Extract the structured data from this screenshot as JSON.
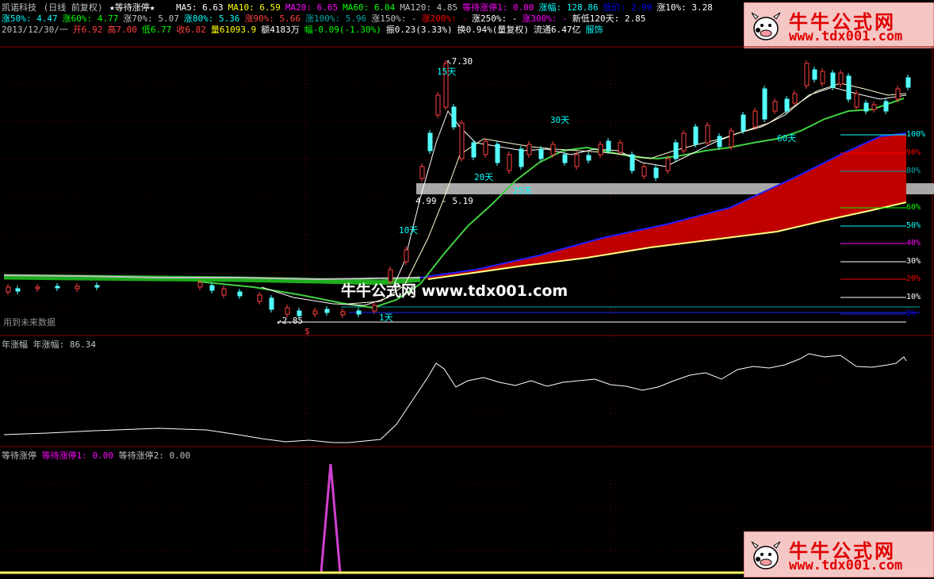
{
  "header": {
    "stock_name": "凯诺科技",
    "period": "(日线 前复权)",
    "indicator_name": "★等待涨停★",
    "ma": [
      {
        "label": "MA5: 6.63",
        "color": "#ffffff"
      },
      {
        "label": "MA10: 6.59",
        "color": "#ffff00"
      },
      {
        "label": "MA20: 6.65",
        "color": "#ff00ff"
      },
      {
        "label": "MA60: 6.04",
        "color": "#00ff00"
      },
      {
        "label": "MA120: 4.85",
        "color": "#c0c0c0"
      },
      {
        "label": "等待涨停1: 0.00",
        "color": "#ff00ff"
      },
      {
        "label": "涨幅: 128.86",
        "color": "#00ffff"
      },
      {
        "label": "低价: 2.99",
        "color": "#0000ff"
      },
      {
        "label": "涨10%: 3.28",
        "color": "#ffffff"
      }
    ],
    "targets": [
      {
        "label": "涨50%: 4.47",
        "color": "#00ffff"
      },
      {
        "label": "涨60%: 4.77",
        "color": "#00ff00"
      },
      {
        "label": "涨70%: 5.07",
        "color": "#c0c0c0"
      },
      {
        "label": "涨80%: 5.36",
        "color": "#00ffff"
      },
      {
        "label": "涨90%: 5.66",
        "color": "#ff4040"
      },
      {
        "label": "涨100%: 5.96",
        "color": "#00aaaa"
      },
      {
        "label": "涨150%: -",
        "color": "#c0c0c0"
      },
      {
        "label": "涨200%: -",
        "color": "#ff0000"
      },
      {
        "label": "涨250%: -",
        "color": "#ffffff"
      },
      {
        "label": "涨300%: -",
        "color": "#ff00ff"
      },
      {
        "label": "新低120天: 2.85",
        "color": "#ffffff"
      }
    ],
    "info": [
      {
        "label": "2013/12/30/一",
        "color": "#c0c0c0"
      },
      {
        "label": "开6.92",
        "color": "#ff4040"
      },
      {
        "label": "高7.00",
        "color": "#ff4040"
      },
      {
        "label": "低6.77",
        "color": "#00ff00"
      },
      {
        "label": "收6.82",
        "color": "#ff4040"
      },
      {
        "label": "量61093.9",
        "color": "#ffff00"
      },
      {
        "label": "额4183万",
        "color": "#ffffff"
      },
      {
        "label": "幅-0.09(-1.30%)",
        "color": "#00ff00"
      },
      {
        "label": "振0.23(3.33%)",
        "color": "#ffffff"
      },
      {
        "label": "换0.94%(量复权)",
        "color": "#ffffff"
      },
      {
        "label": "流通6.47亿",
        "color": "#ffffff"
      },
      {
        "label": "服饰",
        "color": "#00ffff"
      }
    ]
  },
  "chart_labels": {
    "price_high": "7.30",
    "price_low": "2.85",
    "band": "4.99 - 5.19",
    "d10": "10天",
    "d15": "15天",
    "d20": "20天",
    "d25": "25天",
    "d30": "30天",
    "d60": "60天",
    "d1": "1天",
    "future_data": "用到未来数据",
    "dollar": "$"
  },
  "pct_levels": [
    {
      "label": "100%",
      "color": "#00ffff"
    },
    {
      "label": "90%",
      "color": "#ff0000"
    },
    {
      "label": "80%",
      "color": "#00aaaa"
    },
    {
      "label": "60%",
      "color": "#00ff00"
    },
    {
      "label": "50%",
      "color": "#00ffff"
    },
    {
      "label": "40%",
      "color": "#ff00ff"
    },
    {
      "label": "30%",
      "color": "#ffffff"
    },
    {
      "label": "20%",
      "color": "#ff0000"
    },
    {
      "label": "10%",
      "color": "#ffffff"
    },
    {
      "label": "5%",
      "color": "#0000ff"
    }
  ],
  "watermark": "牛牛公式网 www.tdx001.com",
  "badge": {
    "title": "牛牛公式网",
    "url": "www.tdx001.com"
  },
  "panel2": {
    "name": "年涨幅",
    "value_label": "年涨幅: 86.34"
  },
  "panel3": {
    "name": "等待涨停",
    "s1": "等待涨停1: 0.00",
    "s2": "等待涨停2: 0.00"
  }
}
